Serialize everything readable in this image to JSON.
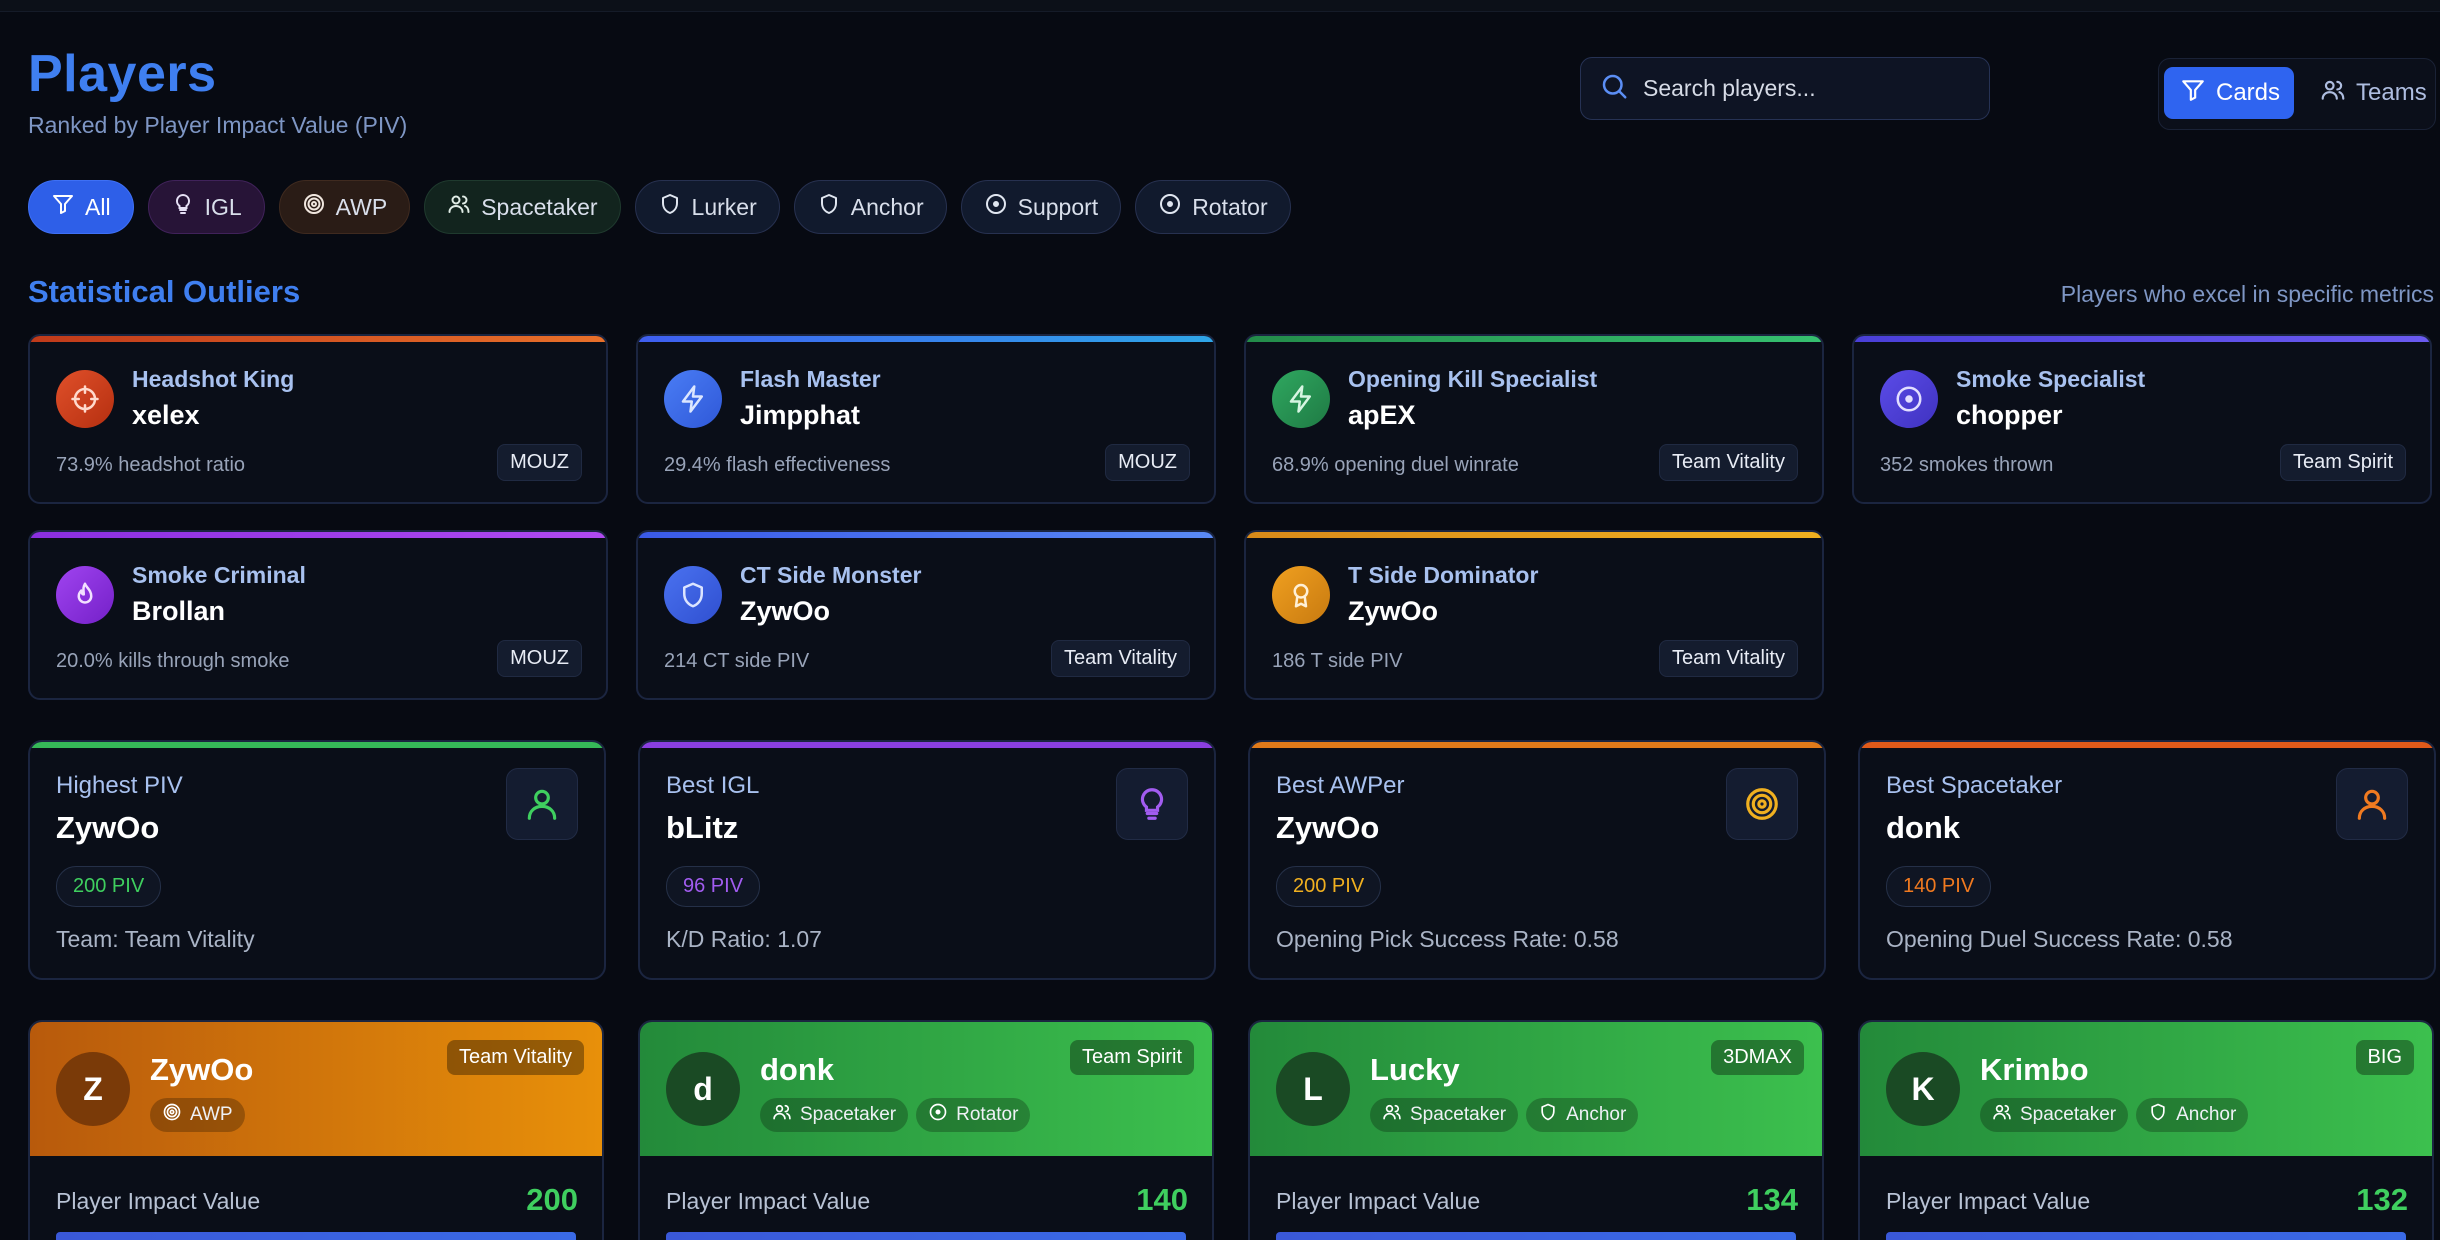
{
  "header": {
    "title": "Players",
    "subtitle": "Ranked by Player Impact Value (PIV)",
    "search_placeholder": "Search players...",
    "view_cards_label": "Cards",
    "view_teams_label": "Teams"
  },
  "filters": [
    "All",
    "IGL",
    "AWP",
    "Spacetaker",
    "Lurker",
    "Anchor",
    "Support",
    "Rotator"
  ],
  "outliers_section": {
    "title": "Statistical Outliers",
    "note": "Players who excel in specific metrics",
    "cards": [
      {
        "label": "Headshot King",
        "player": "xelex",
        "stat": "73.9% headshot ratio",
        "team": "MOUZ",
        "icon": "crosshair-icon",
        "color": "#e5502a"
      },
      {
        "label": "Flash Master",
        "player": "Jimpphat",
        "stat": "29.4% flash effectiveness",
        "team": "MOUZ",
        "icon": "lightning-icon",
        "color": "#3b82f6"
      },
      {
        "label": "Opening Kill Specialist",
        "player": "apEX",
        "stat": "68.9% opening duel winrate",
        "team": "Team Vitality",
        "icon": "lightning-icon",
        "color": "#2fa860"
      },
      {
        "label": "Smoke Specialist",
        "player": "chopper",
        "stat": "352 smokes thrown",
        "team": "Team Spirit",
        "icon": "target-icon",
        "color": "#5b4ce8"
      },
      {
        "label": "Smoke Criminal",
        "player": "Brollan",
        "stat": "20.0% kills through smoke",
        "team": "MOUZ",
        "icon": "flame-icon",
        "color": "#9b3fe8"
      },
      {
        "label": "CT Side Monster",
        "player": "ZywOo",
        "stat": "214 CT side PIV",
        "team": "Team Vitality",
        "icon": "shield-icon",
        "color": "#3f6ee8"
      },
      {
        "label": "T Side Dominator",
        "player": "ZywOo",
        "stat": "186 T side PIV",
        "team": "Team Vitality",
        "icon": "award-icon",
        "color": "#e8a020"
      }
    ]
  },
  "best_cards": [
    {
      "label": "Highest PIV",
      "player": "ZywOo",
      "piv": "200 PIV",
      "meta": "Team: Team Vitality",
      "icon": "user-icon",
      "color": "#3fcf5f"
    },
    {
      "label": "Best IGL",
      "player": "bLitz",
      "piv": "96 PIV",
      "meta": "K/D Ratio: 1.07",
      "icon": "lightbulb-icon",
      "color": "#a25cf0"
    },
    {
      "label": "Best AWPer",
      "player": "ZywOo",
      "piv": "200 PIV",
      "meta": "Opening Pick Success Rate: 0.58",
      "icon": "target-icon",
      "color": "#f0b020"
    },
    {
      "label": "Best Spacetaker",
      "player": "donk",
      "piv": "140 PIV",
      "meta": "Opening Duel Success Rate: 0.58",
      "icon": "user-icon",
      "color": "#f07a20"
    }
  ],
  "player_cards": [
    {
      "initial": "Z",
      "name": "ZywOo",
      "team": "Team Vitality",
      "roles": [
        "AWP"
      ],
      "piv_label": "Player Impact Value",
      "piv": "200",
      "piv_fraction": 1.0
    },
    {
      "initial": "d",
      "name": "donk",
      "team": "Team Spirit",
      "roles": [
        "Spacetaker",
        "Rotator"
      ],
      "piv_label": "Player Impact Value",
      "piv": "140",
      "piv_fraction": 1.0
    },
    {
      "initial": "L",
      "name": "Lucky",
      "team": "3DMAX",
      "roles": [
        "Spacetaker",
        "Anchor"
      ],
      "piv_label": "Player Impact Value",
      "piv": "134",
      "piv_fraction": 1.0
    },
    {
      "initial": "K",
      "name": "Krimbo",
      "team": "BIG",
      "roles": [
        "Spacetaker",
        "Anchor"
      ],
      "piv_label": "Player Impact Value",
      "piv": "132",
      "piv_fraction": 1.0
    }
  ]
}
